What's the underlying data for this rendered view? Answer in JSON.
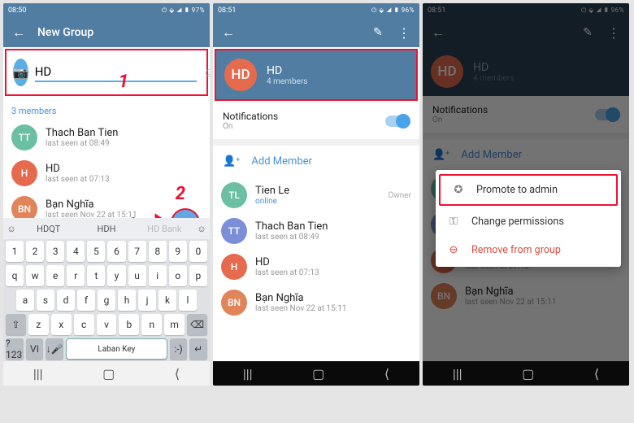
{
  "status": {
    "time1": "08:50",
    "time2": "08:51",
    "time3": "08:51",
    "right": "⏻ ⬙ ◢ ▮ 97%",
    "right2": "⏻ ⬙ ◢ ▮ 96%"
  },
  "p1": {
    "title": "New Group",
    "input_value": "HD",
    "members_label": "3 members",
    "m": [
      {
        "init": "TT",
        "name": "Thach Ban Tien",
        "stat": "last seen at 08:49",
        "bg": "#6bbfa3"
      },
      {
        "init": "H",
        "name": "HD",
        "stat": "last seen at 07:13",
        "bg": "#e66a4e"
      },
      {
        "init": "BN",
        "name": "Bạn Nghĩa",
        "stat": "last seen Nov 22 at 15:11",
        "bg": "#e0845a"
      }
    ],
    "ann1": "1",
    "ann2": "2",
    "sugg": [
      "HDQT",
      "HDH",
      "HD Bank"
    ],
    "rows": [
      [
        "1",
        "2",
        "3",
        "4",
        "5",
        "6",
        "7",
        "8",
        "9",
        "0"
      ],
      [
        "q",
        "w",
        "e",
        "r",
        "t",
        "y",
        "u",
        "i",
        "o",
        "p"
      ],
      [
        "a",
        "s",
        "d",
        "f",
        "g",
        "h",
        "j",
        "k",
        "l"
      ],
      [
        "⇧",
        "z",
        "x",
        "c",
        "v",
        "b",
        "n",
        "m",
        "⌫"
      ]
    ],
    "bot": [
      "?123",
      "VI",
      "↓🎤",
      "Laban Key",
      ":-)",
      "↵"
    ]
  },
  "p2": {
    "grp_name": "HD",
    "grp_sub": "4 members",
    "notif": "Notifications",
    "notif_s": "On",
    "add": "Add Member",
    "owner": "Owner",
    "m": [
      {
        "init": "TL",
        "name": "Tien Le",
        "stat": "online",
        "bg": "#6bbfa3",
        "owner": true,
        "sc": "#4a90d9"
      },
      {
        "init": "TT",
        "name": "Thach Ban Tien",
        "stat": "last seen at 08:49",
        "bg": "#7b8fd9"
      },
      {
        "init": "H",
        "name": "HD",
        "stat": "last seen at 07:13",
        "bg": "#e66a4e"
      },
      {
        "init": "BN",
        "name": "Bạn Nghĩa",
        "stat": "last seen Nov 22 at 15:11",
        "bg": "#e0845a"
      }
    ]
  },
  "p3": {
    "ctx": [
      {
        "icon": "✪",
        "label": "Promote to admin",
        "hl": true
      },
      {
        "icon": "⚿",
        "label": "Change permissions"
      },
      {
        "icon": "⊖",
        "label": "Remove from group",
        "red": true
      }
    ]
  }
}
